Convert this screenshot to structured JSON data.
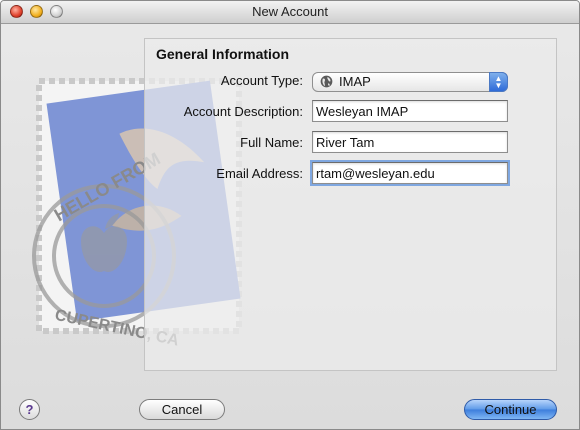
{
  "window": {
    "title": "New Account"
  },
  "form": {
    "heading": "General Information",
    "account_type_label": "Account Type:",
    "account_type_value": "IMAP",
    "description_label": "Account Description:",
    "description_value": "Wesleyan IMAP",
    "full_name_label": "Full Name:",
    "full_name_value": "River Tam",
    "email_label": "Email Address:",
    "email_value": "rtam@wesleyan.edu"
  },
  "stamp": {
    "text_top": "HELLO FROM",
    "text_bottom": "CUPERTINO, CA"
  },
  "buttons": {
    "help": "?",
    "cancel": "Cancel",
    "continue": "Continue"
  },
  "colors": {
    "accent": "#3c7ddc",
    "stamp": "#7f95d6"
  }
}
